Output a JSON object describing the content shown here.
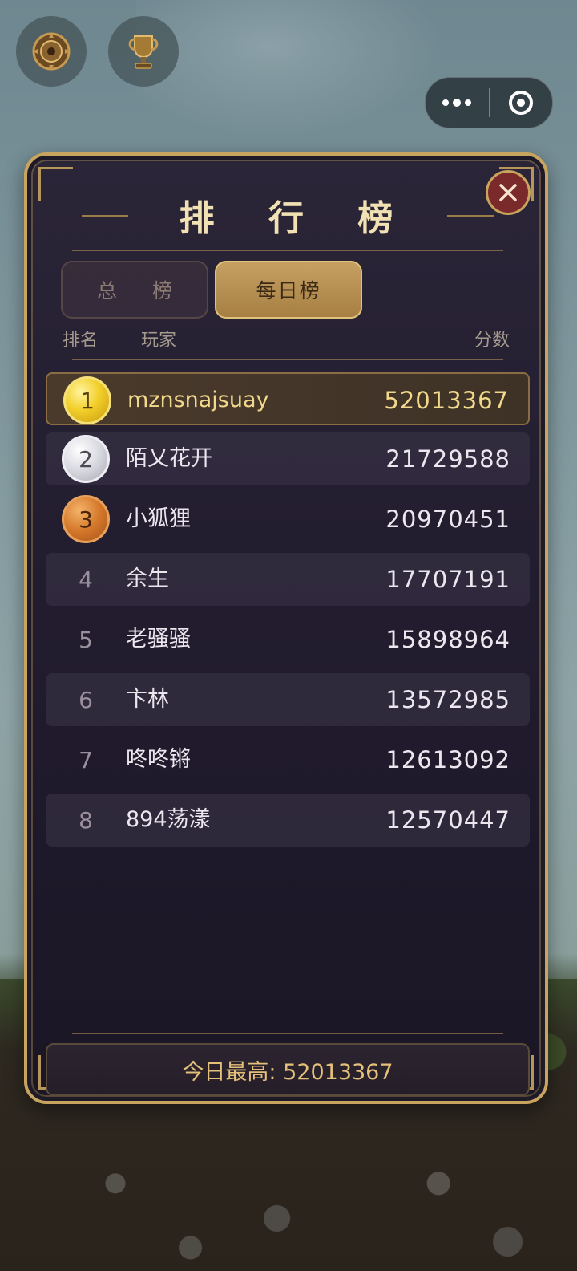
{
  "top_icons": [
    {
      "name": "emblem-icon"
    },
    {
      "name": "trophy-icon"
    }
  ],
  "capsule": {
    "menu_icon": "more-dots-icon",
    "close_icon": "target-icon"
  },
  "panel": {
    "title": "排 行 榜",
    "close_icon": "close-icon",
    "tabs": [
      {
        "label": "总 榜",
        "active": false
      },
      {
        "label": "每日榜",
        "active": true
      }
    ],
    "columns": {
      "rank": "排名",
      "player": "玩家",
      "score": "分数"
    },
    "rows": [
      {
        "rank": "1",
        "name": "mznsnajsuay",
        "score": "52013367",
        "medal": "gold"
      },
      {
        "rank": "2",
        "name": "陌乂花开",
        "score": "21729588",
        "medal": "silver"
      },
      {
        "rank": "3",
        "name": "小狐狸",
        "score": "20970451",
        "medal": "bronze"
      },
      {
        "rank": "4",
        "name": "余生",
        "score": "17707191",
        "medal": ""
      },
      {
        "rank": "5",
        "name": "老骚骚",
        "score": "15898964",
        "medal": ""
      },
      {
        "rank": "6",
        "name": "卞林",
        "score": "13572985",
        "medal": ""
      },
      {
        "rank": "7",
        "name": "咚咚锵",
        "score": "12613092",
        "medal": ""
      },
      {
        "rank": "8",
        "name": "894荡漾",
        "score": "12570447",
        "medal": ""
      }
    ],
    "footer": "今日最高: 52013367"
  },
  "colors": {
    "gold_border": "#c9a45f",
    "panel_bg": "#231d30",
    "active_tab": "#b38b4e",
    "close_bg": "#7a2a2a"
  }
}
